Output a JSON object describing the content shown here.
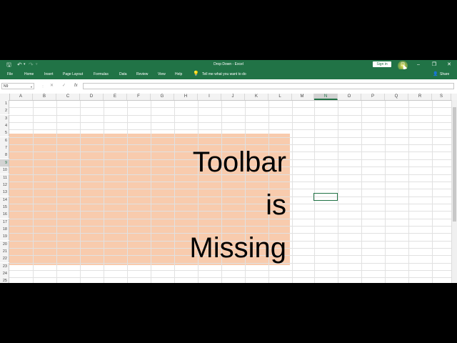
{
  "window": {
    "title": "Drop Down  -  Excel",
    "sign_in_label": "Sign in",
    "controls": {
      "ribbon_display": "⊡",
      "minimize": "–",
      "restore": "❐",
      "close": "✕"
    },
    "quick_access": {
      "save_icon": "save-icon",
      "undo_icon": "undo-icon",
      "redo_icon": "redo-icon",
      "customize_icon": "chevron-down-icon"
    }
  },
  "menu": {
    "items": [
      "File",
      "Home",
      "Insert",
      "Page Layout",
      "Formulas",
      "Data",
      "Review",
      "View",
      "Help"
    ],
    "tell_me": "Tell me what you want to do",
    "share": "Share"
  },
  "formula_bar": {
    "name_box": "N9",
    "cancel": "✕",
    "enter": "✓",
    "fx": "fx",
    "content": ""
  },
  "sheet": {
    "columns": [
      "A",
      "B",
      "C",
      "D",
      "E",
      "F",
      "G",
      "H",
      "I",
      "J",
      "K",
      "L",
      "M",
      "N",
      "O",
      "P",
      "Q",
      "R",
      "S"
    ],
    "rows": [
      "1",
      "2",
      "3",
      "4",
      "5",
      "6",
      "7",
      "8",
      "9",
      "10",
      "11",
      "12",
      "13",
      "14",
      "15",
      "16",
      "17",
      "18",
      "19",
      "20",
      "21",
      "22",
      "23",
      "24",
      "25"
    ],
    "selected_column": "N",
    "selected_row": "9",
    "cell_text": {
      "line1": "Toolbar",
      "line2": "is",
      "line3": "Missing"
    },
    "fill_color": "#f8cbad",
    "accent_color": "#217346"
  }
}
